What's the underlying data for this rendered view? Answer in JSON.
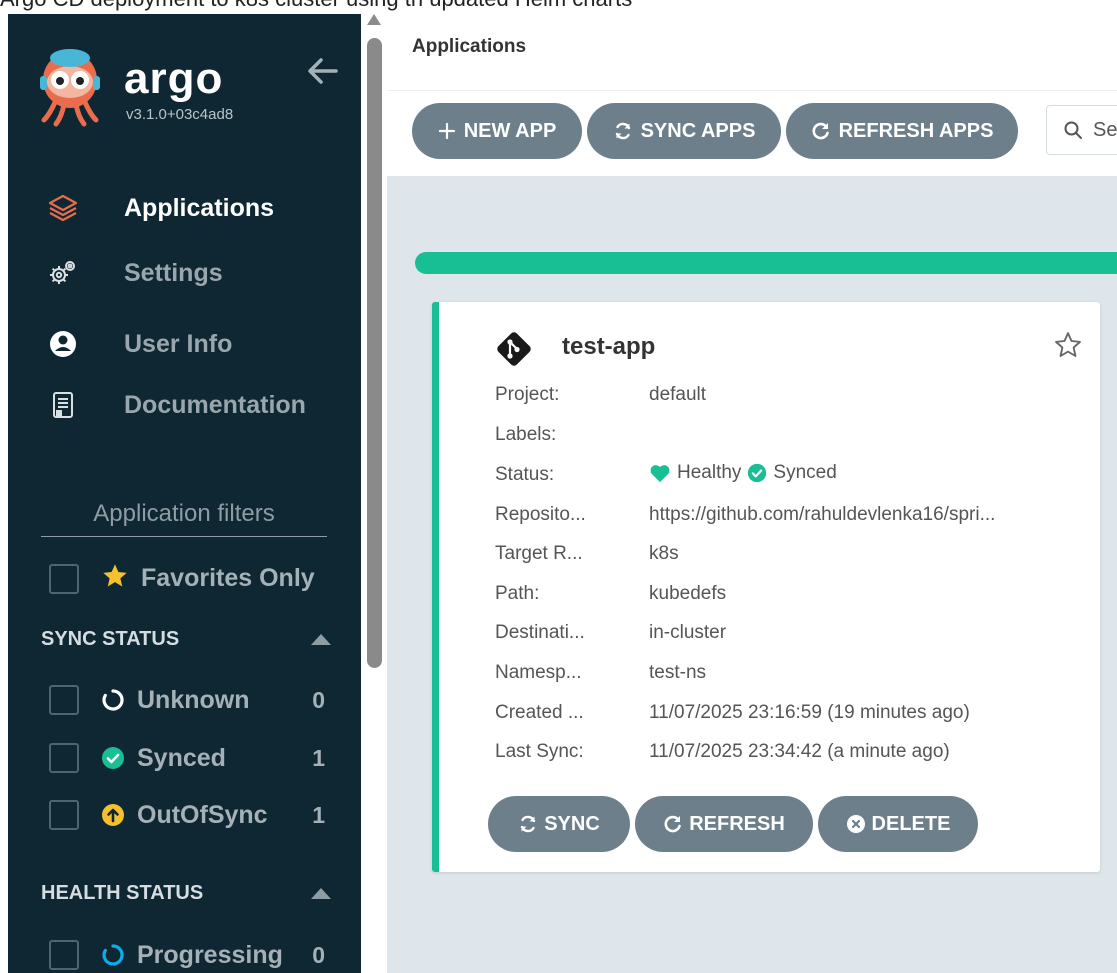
{
  "window": {
    "caption": "Argo CD deployment to k8s cluster using th updated Helm charts"
  },
  "sidebar": {
    "logo_text": "argo",
    "version": "v3.1.0+03c4ad8",
    "nav": [
      {
        "label": "Applications",
        "icon": "layers-icon"
      },
      {
        "label": "Settings",
        "icon": "gears-icon"
      },
      {
        "label": "User Info",
        "icon": "user-circle-icon"
      },
      {
        "label": "Documentation",
        "icon": "book-icon"
      }
    ],
    "filters_title": "Application filters",
    "favorites_label": "Favorites Only",
    "sync_status": {
      "heading": "SYNC STATUS",
      "items": [
        {
          "label": "Unknown",
          "count": "0",
          "color": "#ffffff"
        },
        {
          "label": "Synced",
          "count": "1",
          "color": "#18be94"
        },
        {
          "label": "OutOfSync",
          "count": "1",
          "color": "#f4c030"
        }
      ]
    },
    "health_status": {
      "heading": "HEALTH STATUS",
      "items": [
        {
          "label": "Progressing",
          "count": "0",
          "color": "#0dadea"
        }
      ]
    }
  },
  "header": {
    "title": "Applications"
  },
  "toolbar": {
    "new_app": "NEW APP",
    "sync_apps": "SYNC APPS",
    "refresh_apps": "REFRESH APPS",
    "search_placeholder": "Se"
  },
  "app_card": {
    "name": "test-app",
    "fields": {
      "project": {
        "label": "Project:",
        "value": "default"
      },
      "labels": {
        "label": "Labels:",
        "value": ""
      },
      "status": {
        "label": "Status:",
        "health": "Healthy",
        "sync": "Synced"
      },
      "repository": {
        "label": "Reposito...",
        "value": "https://github.com/rahuldevlenka16/spri..."
      },
      "target_revision": {
        "label": "Target R...",
        "value": "k8s"
      },
      "path": {
        "label": "Path:",
        "value": "kubedefs"
      },
      "destination": {
        "label": "Destinati...",
        "value": "in-cluster"
      },
      "namespace": {
        "label": "Namesp...",
        "value": "test-ns"
      },
      "created": {
        "label": "Created ...",
        "value": "11/07/2025 23:16:59  (19 minutes ago)"
      },
      "last_sync": {
        "label": "Last Sync:",
        "value": "11/07/2025 23:34:42  (a minute ago)"
      }
    },
    "buttons": {
      "sync": "SYNC",
      "refresh": "REFRESH",
      "delete": "DELETE"
    }
  },
  "colors": {
    "sidebar_bg": "#0f2733",
    "accent_green": "#18be94",
    "button_gray": "#6d7f8b",
    "main_bg": "#dee6eb",
    "logo_orange": "#e96d4c"
  }
}
